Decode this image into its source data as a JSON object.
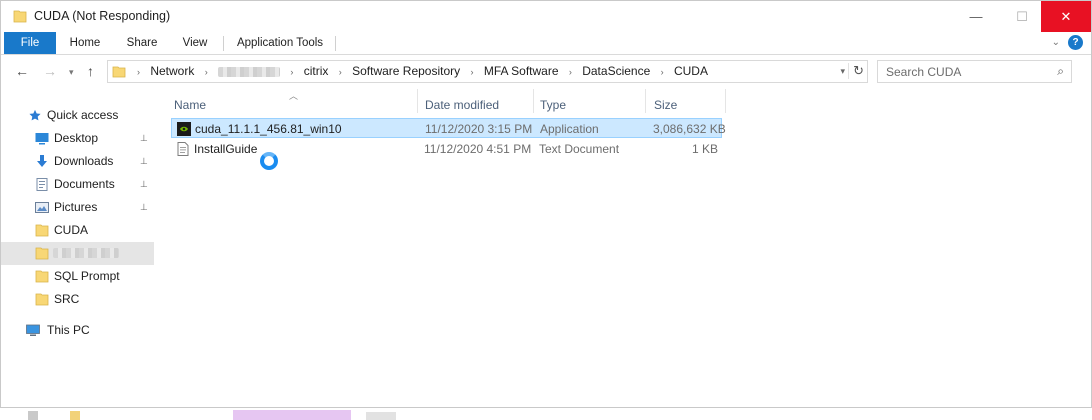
{
  "window": {
    "title": "CUDA (Not Responding)",
    "controls": {
      "minimize": "—",
      "maximize": "☐",
      "close": "✕"
    }
  },
  "ribbon": {
    "tabs": [
      "File",
      "Home",
      "Share",
      "View",
      "Application Tools"
    ],
    "collapse_glyph": "⌄",
    "help_glyph": "?"
  },
  "address": {
    "crumbs": [
      "Network",
      "citrix",
      "Software Repository",
      "MFA Software",
      "DataScience",
      "CUDA"
    ],
    "redacted_after": "Network"
  },
  "search": {
    "placeholder": "Search CUDA"
  },
  "nav": {
    "quick_access": "Quick access",
    "items": [
      {
        "label": "Desktop",
        "icon": "desktop-icon",
        "pinned": true
      },
      {
        "label": "Downloads",
        "icon": "downloads-icon",
        "pinned": true
      },
      {
        "label": "Documents",
        "icon": "documents-icon",
        "pinned": true
      },
      {
        "label": "Pictures",
        "icon": "pictures-icon",
        "pinned": true
      },
      {
        "label": "CUDA",
        "icon": "folder-icon",
        "pinned": false
      },
      {
        "label": "",
        "icon": "folder-icon",
        "pinned": false,
        "redacted": true,
        "selected": true
      },
      {
        "label": "SQL Prompt",
        "icon": "folder-icon",
        "pinned": false
      },
      {
        "label": "SRC",
        "icon": "folder-icon",
        "pinned": false
      }
    ],
    "this_pc": "This PC",
    "pin_glyph": "📌"
  },
  "files": {
    "columns": [
      "Name",
      "Date modified",
      "Type",
      "Size"
    ],
    "rows": [
      {
        "name": "cuda_11.1.1_456.81_win10",
        "date": "11/12/2020 3:15 PM",
        "type": "Application",
        "size": "3,086,632 KB",
        "icon": "nvidia-app-icon",
        "selected": true
      },
      {
        "name": "InstallGuide",
        "date": "11/12/2020 4:51 PM",
        "type": "Text Document",
        "size": "1 KB",
        "icon": "text-document-icon",
        "selected": false
      }
    ]
  },
  "colors": {
    "file_tab": "#1979ca",
    "close_button": "#e81123",
    "selection": "#cce8ff",
    "busy_cursor": "#1a8cf0",
    "header_text": "#4c607a"
  }
}
